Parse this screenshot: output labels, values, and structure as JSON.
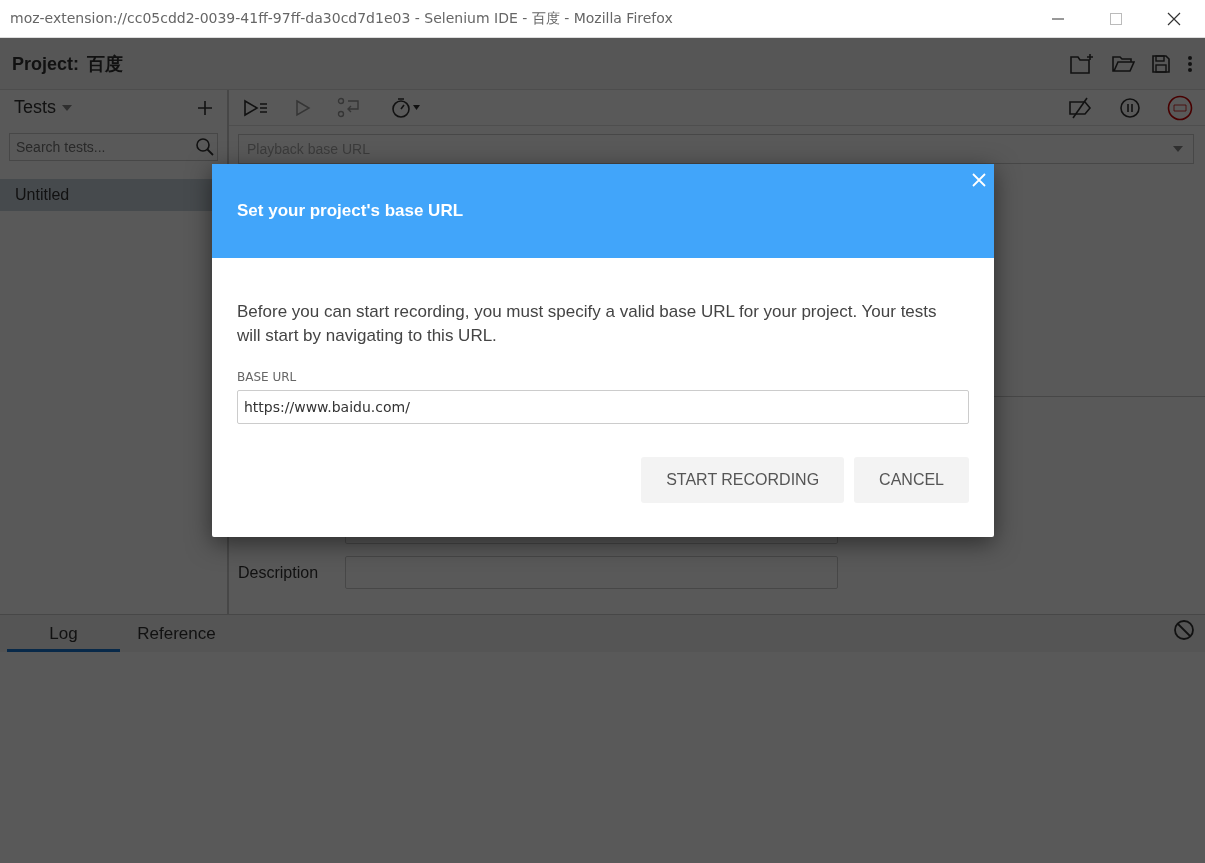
{
  "window": {
    "title": "moz-extension://cc05cdd2-0039-41ff-97ff-da30cd7d1e03 - Selenium IDE - 百度 - Mozilla Firefox"
  },
  "project": {
    "label": "Project:",
    "name": "百度"
  },
  "sidebar": {
    "header": "Tests",
    "search_placeholder": "Search tests...",
    "tests": [
      {
        "name": "Untitled",
        "selected": true
      }
    ]
  },
  "toolbar": {
    "base_url_placeholder": "Playback base URL"
  },
  "command_form": {
    "description_label": "Description"
  },
  "bottom_panel": {
    "tabs": [
      {
        "label": "Log",
        "selected": true
      },
      {
        "label": "Reference",
        "selected": false
      }
    ]
  },
  "dialog": {
    "title": "Set your project's base URL",
    "message": "Before you can start recording, you must specify a valid base URL for your project. Your tests will start by navigating to this URL.",
    "field_label": "BASE URL",
    "field_value": "https://www.baidu.com/",
    "buttons": [
      "START RECORDING",
      "CANCEL"
    ]
  }
}
